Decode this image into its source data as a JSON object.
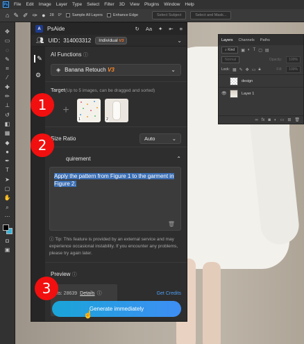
{
  "menubar": {
    "items": [
      "File",
      "Edit",
      "Image",
      "Layer",
      "Type",
      "Select",
      "Filter",
      "3D",
      "View",
      "Plugins",
      "Window",
      "Help"
    ]
  },
  "options_bar": {
    "brush_size": "28",
    "angle": "0°",
    "sample_all_layers": "Sample All Layers",
    "enhance_edge": "Enhance Edge",
    "select_subject": "Select Subject",
    "select_and_mask": "Select and Mask..."
  },
  "layers_panel": {
    "tabs": [
      "Layers",
      "Channels",
      "Paths"
    ],
    "kind_label": "Kind",
    "blend_mode": "Normal",
    "opacity_label": "Opacity:",
    "opacity_value": "100%",
    "lock_label": "Lock:",
    "fill_label": "Fill:",
    "fill_value": "100%",
    "layers": [
      {
        "name": "design",
        "visible": false
      },
      {
        "name": "Layer 1",
        "visible": true
      }
    ]
  },
  "plugin": {
    "title": "PsAide",
    "uid_label": "UID：314003312",
    "plan": "Individual",
    "plan_badge": "V3",
    "ai_functions_label": "AI Functions",
    "model_name": "Banana Retouch",
    "model_version": "V3",
    "target_label": "Target",
    "target_sub": "(Up to 5 images, can be dragged and sorted)",
    "target_images": [
      {
        "index": "1",
        "kind": "pattern"
      },
      {
        "index": "2",
        "kind": "model"
      }
    ],
    "size_ratio_label": "Size Ratio",
    "size_ratio_value": "Auto",
    "requirement_label": "Requirement",
    "requirement_label_visible": "quirement",
    "requirement_text": "Apply the pattern from Figure 1 to the garment in Figure 2.",
    "tip_text": "Tip: This feature is provided by an external service and may experience occasional instability. If you encounter any problems, please try again later.",
    "preview_label": "Preview",
    "credits_text": "edits: 28639",
    "details_label": "Details",
    "get_credits_label": "Get Credits",
    "generate_label": "Generate immediately"
  },
  "markers": [
    "1",
    "2",
    "3"
  ],
  "colors": {
    "accent": "#3e8ef5",
    "marker": "#f20f0f",
    "highlight": "#3c6fb4",
    "version_orange": "#ff8a2a"
  }
}
